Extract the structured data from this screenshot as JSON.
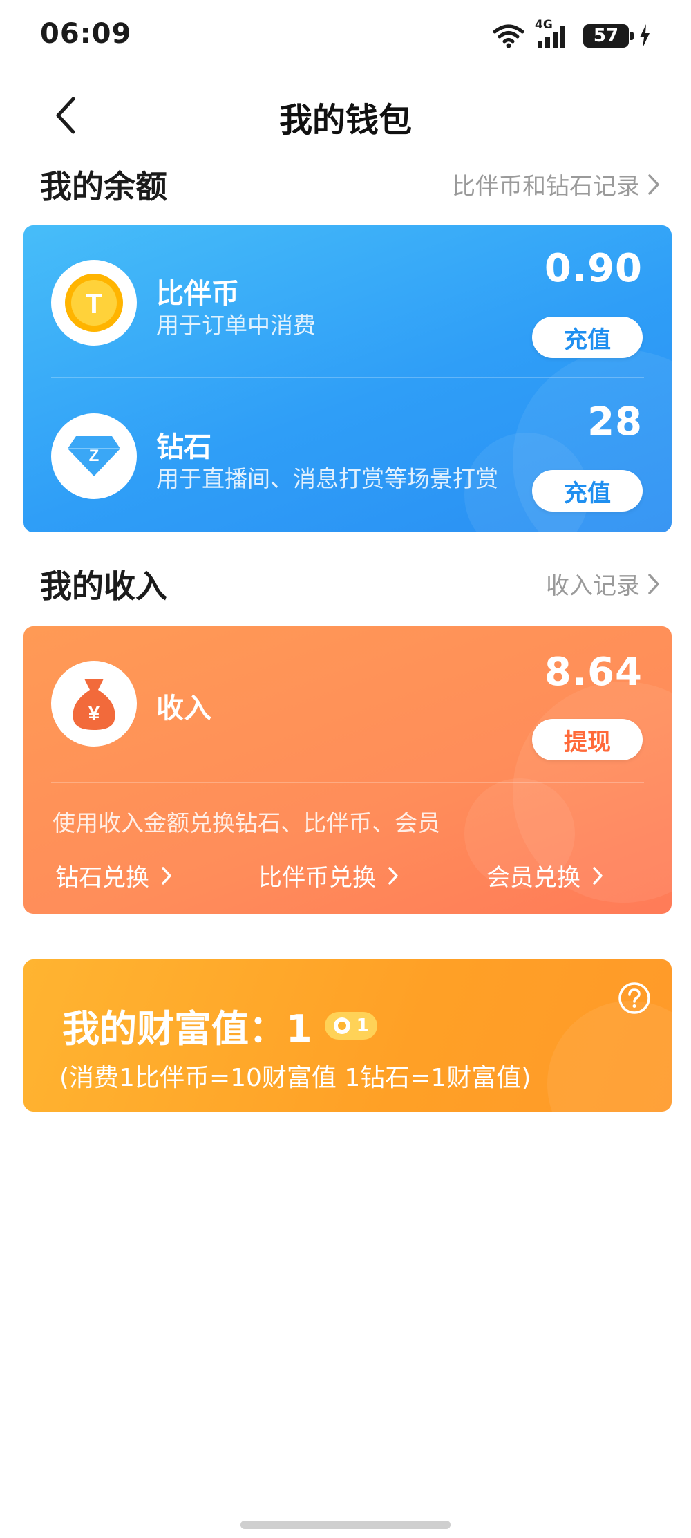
{
  "status_bar": {
    "time": "06:09",
    "network": "4G",
    "battery": "57"
  },
  "nav": {
    "title": "我的钱包"
  },
  "balance_section": {
    "title": "我的余额",
    "link_label": "比伴币和钻石记录"
  },
  "balance": {
    "coin": {
      "name": "比伴币",
      "desc": "用于订单中消费",
      "value": "0.90",
      "button": "充值",
      "icon_letter": "T"
    },
    "diamond": {
      "name": "钻石",
      "desc": "用于直播间、消息打赏等场景打赏",
      "value": "28",
      "button": "充值",
      "icon_letter": "Z"
    }
  },
  "income_section": {
    "title": "我的收入",
    "link_label": "收入记录"
  },
  "income": {
    "name": "收入",
    "value": "8.64",
    "button": "提现",
    "icon_symbol": "¥",
    "note": "使用收入金额兑换钻石、比伴币、会员",
    "exchanges": [
      "钻石兑换",
      "比伴币兑换",
      "会员兑换"
    ]
  },
  "wealth": {
    "title": "我的财富值：1",
    "badge_level": "1",
    "note": "(消费1比伴币=10财富值 1钻石=1财富值)"
  },
  "colors": {
    "blue_card": "#2f9ef7",
    "orange_card": "#ff8d5a",
    "gold_card": "#ffa026",
    "pill_blue_text": "#1f8ff0",
    "pill_orange_text": "#ff6a3a"
  },
  "icons": [
    "wifi-icon",
    "signal-icon",
    "battery-icon",
    "charging-icon",
    "back-chevron-icon",
    "chevron-right-icon",
    "coin-icon",
    "diamond-icon",
    "money-bag-icon",
    "help-icon"
  ]
}
